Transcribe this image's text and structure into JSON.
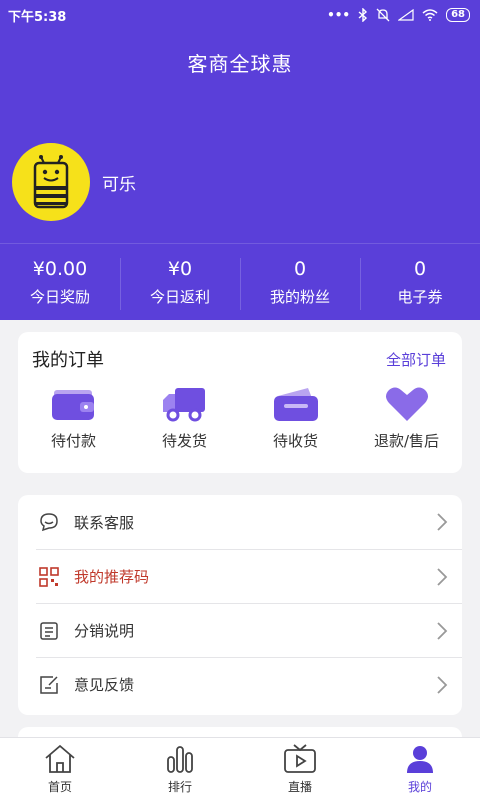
{
  "status_bar": {
    "time": "下午5:38",
    "dots": "•••",
    "battery": "68"
  },
  "header": {
    "title": "客商全球惠",
    "username": "可乐",
    "background_color": "#5a3fd9"
  },
  "stats": [
    {
      "value": "¥0.00",
      "label": "今日奖励"
    },
    {
      "value": "¥0",
      "label": "今日返利"
    },
    {
      "value": "0",
      "label": "我的粉丝"
    },
    {
      "value": "0",
      "label": "电子券"
    }
  ],
  "orders": {
    "title": "我的订单",
    "all_link": "全部订单",
    "items": [
      {
        "label": "待付款",
        "icon": "wallet-icon"
      },
      {
        "label": "待发货",
        "icon": "truck-icon"
      },
      {
        "label": "待收货",
        "icon": "card-wallet-icon"
      },
      {
        "label": "退款/售后",
        "icon": "heart-icon"
      }
    ]
  },
  "menu": [
    {
      "label": "联系客服",
      "icon": "chat-icon"
    },
    {
      "label": "我的推荐码",
      "icon": "qr-code-icon",
      "color": "#c0392b"
    },
    {
      "label": "分销说明",
      "icon": "document-icon"
    },
    {
      "label": "意见反馈",
      "icon": "feedback-icon"
    }
  ],
  "tabbar": [
    {
      "label": "首页",
      "icon": "home-icon"
    },
    {
      "label": "排行",
      "icon": "ranking-icon"
    },
    {
      "label": "直播",
      "icon": "live-tv-icon"
    },
    {
      "label": "我的",
      "icon": "user-icon",
      "active": true
    }
  ],
  "accent_color": "#5a3fd9"
}
